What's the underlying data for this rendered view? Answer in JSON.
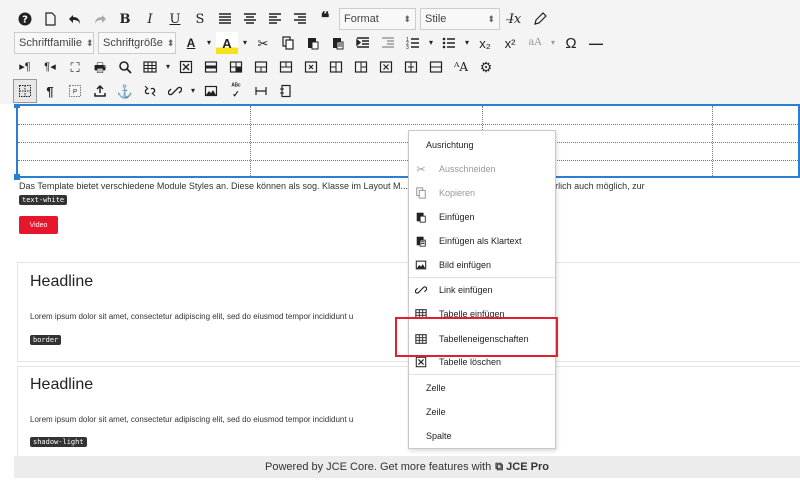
{
  "toolbar": {
    "format_label": "Format",
    "stile_label": "Stile",
    "schriftfamilie_label": "Schriftfamilie",
    "schriftgroesse_label": "Schriftgröße",
    "font_color_glyph": "A",
    "highlight_glyph": "A",
    "subscript_glyph": "x₂",
    "superscript_glyph": "x²",
    "case_glyph": "aA",
    "omega_glyph": "Ω",
    "find_replace_glyph": "ᴬA",
    "highlight_color": "#f6e21a",
    "font_color": "#222222"
  },
  "editor": {
    "paragraph": "Das Template bietet verschiedene Module Styles an. Diese können als sog. Klasse im Layout M... Eine Kombination der Styles ist natürlich auch möglich, zur",
    "code_text_white": "text-white",
    "video_button": "Video",
    "card1": {
      "headline": "Headline",
      "text": "Lorem ipsum dolor sit amet, consectetur adipiscing elit, sed do eiusmod tempor incididunt u",
      "code": "border"
    },
    "card2": {
      "headline": "Headline",
      "text": "Lorem ipsum dolor sit amet, consectetur adipiscing elit, sed do eiusmod tempor incididunt u",
      "code": "shadow-light"
    },
    "accent_color": "#2a7fd4",
    "button_color": "#e6162d"
  },
  "context_menu": {
    "items": [
      {
        "label": "Ausrichtung",
        "icon": "",
        "disabled": false
      },
      {
        "label": "Ausschneiden",
        "icon": "scissors-icon",
        "disabled": true
      },
      {
        "label": "Kopieren",
        "icon": "copy-icon",
        "disabled": true
      },
      {
        "label": "Einfügen",
        "icon": "paste-icon",
        "disabled": false
      },
      {
        "label": "Einfügen als Klartext",
        "icon": "paste-text-icon",
        "disabled": false
      },
      {
        "label": "Bild einfügen",
        "icon": "image-icon",
        "disabled": false
      },
      {
        "label": "Link einfügen",
        "icon": "link-icon",
        "disabled": false
      },
      {
        "label": "Tabelle einfügen",
        "icon": "table-icon",
        "disabled": false
      },
      {
        "label": "Tabelleneigenschaften",
        "icon": "table-props-icon",
        "disabled": false
      },
      {
        "label": "Tabelle löschen",
        "icon": "table-delete-icon",
        "disabled": false
      },
      {
        "label": "Zelle",
        "icon": "",
        "disabled": false
      },
      {
        "label": "Zeile",
        "icon": "",
        "disabled": false
      },
      {
        "label": "Spalte",
        "icon": "",
        "disabled": false
      }
    ],
    "highlight_color": "#e0202e"
  },
  "footer": {
    "text": "Powered by JCE Core. Get more features with",
    "pro_label": "JCE Pro"
  }
}
